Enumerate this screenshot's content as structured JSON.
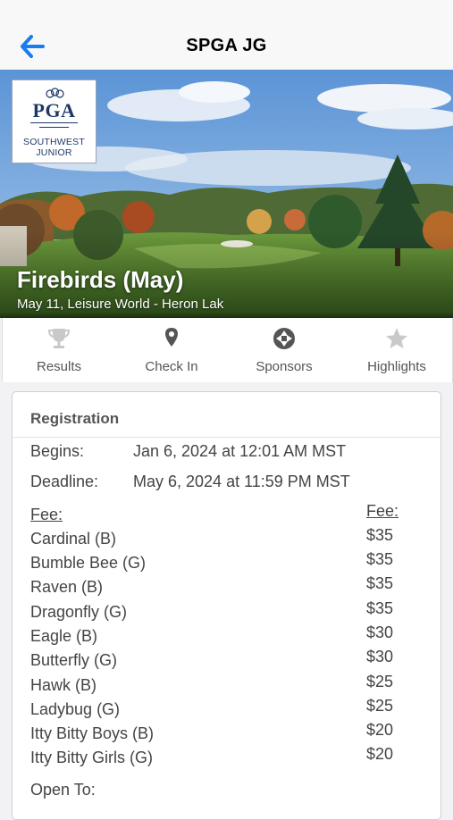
{
  "header": {
    "title": "SPGA JG",
    "back_icon": "back-arrow-icon",
    "accent": "#1a7cf0"
  },
  "logo": {
    "line1": "PGA",
    "line2": "SOUTHWEST",
    "line3": "JUNIOR"
  },
  "event": {
    "title": "Firebirds (May)",
    "subtitle": "May 11, Leisure World - Heron Lak"
  },
  "tabs": [
    {
      "label": "Results",
      "icon": "trophy-icon"
    },
    {
      "label": "Check In",
      "icon": "map-pin-icon"
    },
    {
      "label": "Sponsors",
      "icon": "camera-aperture-icon"
    },
    {
      "label": "Highlights",
      "icon": "star-icon"
    }
  ],
  "registration": {
    "title": "Registration",
    "begins_label": "Begins:",
    "begins_value": "Jan 6, 2024 at 12:01 AM MST",
    "deadline_label": "Deadline:",
    "deadline_value": "May 6, 2024 at 11:59 PM MST",
    "fee_header_left": "Fee:",
    "fee_header_right": "Fee:",
    "fees": [
      {
        "name": "Cardinal (B)",
        "amount": "$35"
      },
      {
        "name": "Bumble Bee (G)",
        "amount": "$35"
      },
      {
        "name": "Raven (B)",
        "amount": "$35"
      },
      {
        "name": "Dragonfly (G)",
        "amount": "$35"
      },
      {
        "name": "Eagle (B)",
        "amount": "$30"
      },
      {
        "name": "Butterfly (G)",
        "amount": "$30"
      },
      {
        "name": "Hawk (B)",
        "amount": "$25"
      },
      {
        "name": "Ladybug (G)",
        "amount": "$25"
      },
      {
        "name": "Itty Bitty Boys (B)",
        "amount": "$20"
      },
      {
        "name": "Itty Bitty Girls (G)",
        "amount": "$20"
      }
    ],
    "open_to_label": "Open To:"
  }
}
